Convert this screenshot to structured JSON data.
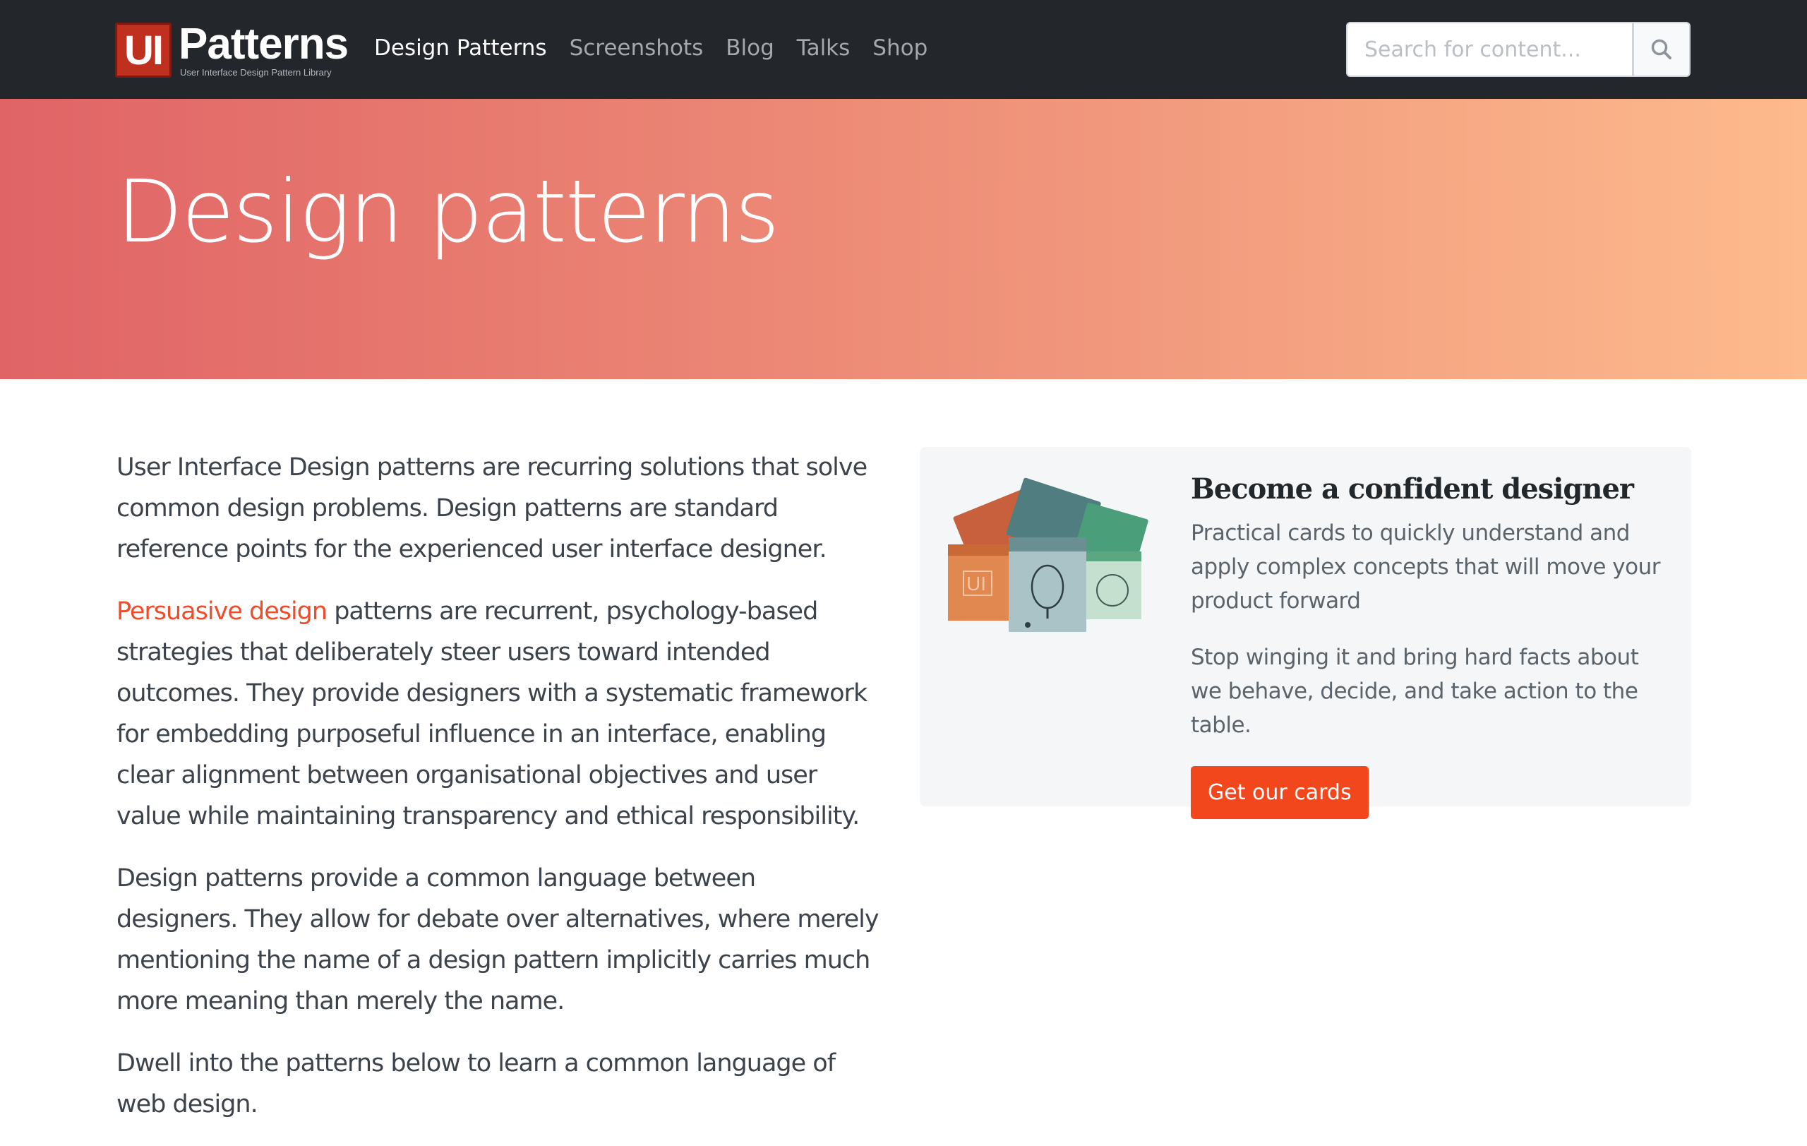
{
  "logo": {
    "badge": "UI",
    "title": "Patterns",
    "subtitle": "User Interface Design Pattern Library"
  },
  "nav": {
    "items": [
      {
        "label": "Design Patterns",
        "active": true
      },
      {
        "label": "Screenshots",
        "active": false
      },
      {
        "label": "Blog",
        "active": false
      },
      {
        "label": "Talks",
        "active": false
      },
      {
        "label": "Shop",
        "active": false
      }
    ]
  },
  "search": {
    "placeholder": "Search for content...",
    "icon": "search-icon"
  },
  "hero": {
    "title": "Design patterns"
  },
  "intro": {
    "p1": "User Interface Design patterns are recurring solutions that solve common design problems. Design patterns are standard reference points for the experienced user interface designer.",
    "p2_link": "Persuasive design",
    "p2_rest": " patterns are recurrent, psychology-based strategies that deliberately steer users toward intended outcomes. They provide designers with a systematic framework for embedding purposeful influence in an interface, enabling clear alignment between organisational objectives and user value while maintaining transparency and ethical responsibility.",
    "p3": "Design patterns provide a common language between designers. They allow for debate over alternatives, where merely mentioning the name of a design pattern implicitly carries much more meaning than merely the name.",
    "p4": "Dwell into the patterns below to learn a common language of web design."
  },
  "promo": {
    "title": "Become a confident designer",
    "text1": "Practical cards to quickly understand and apply complex concepts that will move your product forward",
    "text2": "Stop winging it and bring hard facts about we behave, decide, and take action to the table.",
    "button": "Get our cards",
    "image_label_ui": "UI"
  },
  "colors": {
    "navbar": "#23272b",
    "accent": "#f2471d",
    "hero_start": "#e06466",
    "hero_end": "#fdba8c"
  }
}
